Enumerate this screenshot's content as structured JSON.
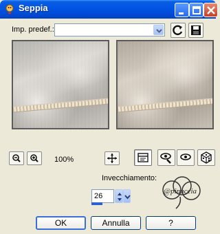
{
  "window": {
    "title": "Seppia"
  },
  "preset": {
    "label": "Imp. predef.:",
    "value": ""
  },
  "zoom": {
    "level": "100%"
  },
  "aging": {
    "label": "Invecchiamento:",
    "value": "26",
    "slider_fraction": 0.26
  },
  "logo": {
    "text": "@pinuccia"
  },
  "buttons": {
    "ok": "OK",
    "cancel": "Annulla",
    "help": "?"
  },
  "colors": {
    "titlebar": "#0054e3",
    "dialog": "#ece9d8",
    "accent": "#2f5fd0"
  }
}
